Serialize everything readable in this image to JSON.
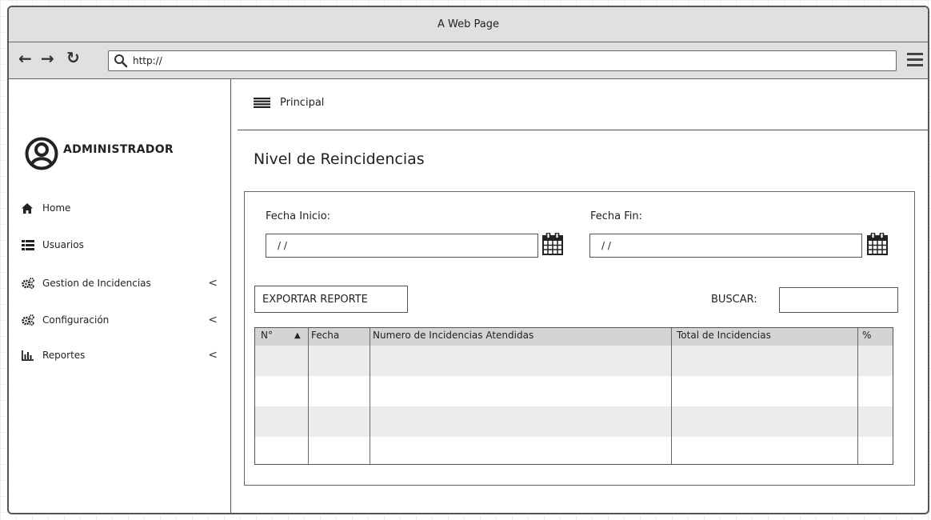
{
  "browser": {
    "title": "A Web Page",
    "url": "http://"
  },
  "sidebar": {
    "user": "ADMINISTRADOR",
    "items": [
      {
        "label": "Home",
        "icon": "home-icon",
        "has_submenu": false
      },
      {
        "label": "Usuarios",
        "icon": "list-icon",
        "has_submenu": false
      },
      {
        "label": "Gestion de Incidencias",
        "icon": "cogs-icon",
        "has_submenu": true
      },
      {
        "label": "Configuración",
        "icon": "cogs-icon",
        "has_submenu": true
      },
      {
        "label": "Reportes",
        "icon": "bar-chart-icon",
        "has_submenu": true
      }
    ],
    "chevron": "<"
  },
  "header": {
    "breadcrumb": "Principal"
  },
  "main": {
    "title": "Nivel de Reincidencias",
    "fecha_inicio_label": "Fecha Inicio:",
    "fecha_inicio_value": "/ /",
    "fecha_fin_label": "Fecha Fin:",
    "fecha_fin_value": "/ /",
    "export_button": "EXPORTAR REPORTE",
    "search_label": "BUSCAR:",
    "search_value": ""
  },
  "table": {
    "columns": [
      "N°",
      "Fecha",
      "Numero de Incidencias Atendidas",
      "Total de Incidencias",
      "%"
    ],
    "sort_indicator": "▲",
    "rows": []
  }
}
